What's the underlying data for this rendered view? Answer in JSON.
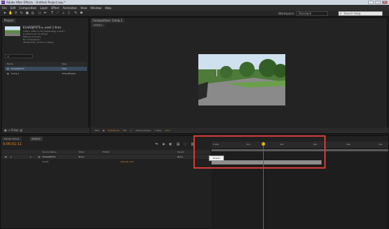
{
  "window": {
    "title": "Adobe After Effects - Untitled Project.aep *",
    "app_icon": "Ae",
    "buttons": [
      "–",
      "□",
      "×"
    ]
  },
  "menu": [
    "File",
    "Edit",
    "Composition",
    "Layer",
    "Effect",
    "Animation",
    "View",
    "Window",
    "Help"
  ],
  "toolbar": {
    "workspace_label": "Workspace:",
    "workspace_value": "Standard",
    "search_placeholder": "Search Help"
  },
  "project": {
    "tab": "Project",
    "item_name": "EG4ADJPSTS ▾, used 1 time",
    "info": [
      "1440 x 1080 (1.33) (Separating 1 layer)",
      "Δ 0;00;11;15, 25.00 fps",
      "Millions of Colors",
      "No Compression",
      "48.000 kHz / 32 bit U / Stereo"
    ],
    "search_placeholder": "ρ▾",
    "columns": {
      "name": "Name",
      "type": "Type"
    },
    "rows": [
      {
        "name": "EG4ADJPSTS",
        "type": "Pixel"
      },
      {
        "name": "Comp 1",
        "type": "Ψ Synthesize"
      }
    ],
    "footer": "8 bpc"
  },
  "composition": {
    "tab": "Composition: Comp 1",
    "sub_tab": "Comp 1",
    "footer": {
      "zoom": "50%",
      "time": "0;00;01;11",
      "res": "Full",
      "camera": "Active Camera",
      "view": "1 View",
      "exposure": "+0.0"
    }
  },
  "timeline": {
    "tabs": [
      "Render Queue",
      "Comp 1"
    ],
    "timecode": "0;00;01;11",
    "columns": {
      "source": "Source Name",
      "mode": "Mode",
      "trkmat": "TrkMat",
      "parent": "Parent"
    },
    "layer": {
      "index": "1",
      "name": "EG4ADJPSTS",
      "mode": "Norm",
      "parent": "None"
    },
    "sub_layer": {
      "name": "Audio",
      "value": "0;00;01;11%"
    },
    "ruler": [
      "0:00s",
      "02s",
      "04s",
      "06s",
      "08s",
      "10s"
    ],
    "tooltip": "Stretch"
  },
  "colors": {
    "accent_orange": "#e0902b",
    "playhead_red": "#d93030",
    "highlight_red": "#d63a3a"
  }
}
